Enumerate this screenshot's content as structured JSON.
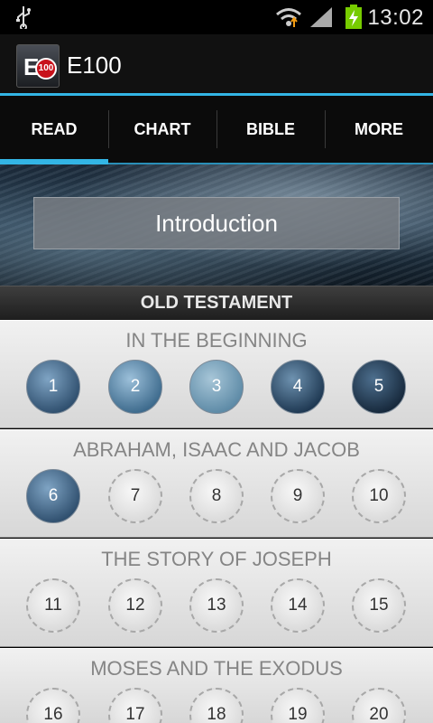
{
  "status": {
    "time": "13:02",
    "icons": [
      "usb-icon",
      "wifi-icon",
      "signal-icon",
      "battery-charging-icon"
    ]
  },
  "app": {
    "title": "E100",
    "logo": {
      "letter": "E",
      "badge": "100"
    }
  },
  "tabs": [
    {
      "label": "READ",
      "active": true
    },
    {
      "label": "CHART",
      "active": false
    },
    {
      "label": "BIBLE",
      "active": false
    },
    {
      "label": "MORE",
      "active": false
    }
  ],
  "intro_button": "Introduction",
  "section": "OLD TESTAMENT",
  "groups": [
    {
      "title": "IN THE BEGINNING",
      "items": [
        {
          "n": "1",
          "done": true
        },
        {
          "n": "2",
          "done": true
        },
        {
          "n": "3",
          "done": true
        },
        {
          "n": "4",
          "done": true
        },
        {
          "n": "5",
          "done": true
        }
      ]
    },
    {
      "title": "ABRAHAM, ISAAC AND JACOB",
      "items": [
        {
          "n": "6",
          "done": true
        },
        {
          "n": "7",
          "done": false
        },
        {
          "n": "8",
          "done": false
        },
        {
          "n": "9",
          "done": false
        },
        {
          "n": "10",
          "done": false
        }
      ]
    },
    {
      "title": "THE STORY OF JOSEPH",
      "items": [
        {
          "n": "11",
          "done": false
        },
        {
          "n": "12",
          "done": false
        },
        {
          "n": "13",
          "done": false
        },
        {
          "n": "14",
          "done": false
        },
        {
          "n": "15",
          "done": false
        }
      ]
    },
    {
      "title": "MOSES AND THE EXODUS",
      "items": [
        {
          "n": "16",
          "done": false
        },
        {
          "n": "17",
          "done": false
        },
        {
          "n": "18",
          "done": false
        },
        {
          "n": "19",
          "done": false
        },
        {
          "n": "20",
          "done": false
        }
      ]
    }
  ],
  "colors": {
    "accent": "#33b5e5",
    "done_circle": "#2f4f6e",
    "group_title": "#858585"
  }
}
